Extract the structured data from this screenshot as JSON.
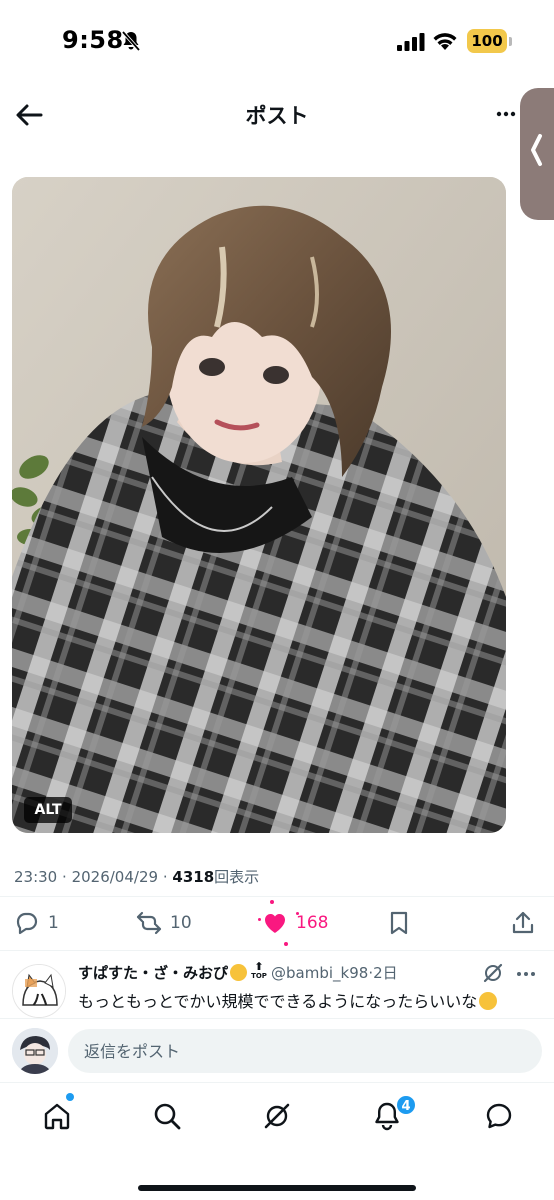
{
  "status_bar": {
    "time": "9:58",
    "battery": "100",
    "icons": [
      "bell-slash-icon",
      "signal-icon",
      "wifi-icon",
      "battery-icon"
    ]
  },
  "header": {
    "title": "ポスト",
    "icons": [
      "back-arrow-icon",
      "more-icon"
    ]
  },
  "media": {
    "alt_label": "ALT",
    "description": "selfie photo"
  },
  "meta": {
    "time": "23:30",
    "date": "2026/04/29",
    "views": "4318",
    "views_label": "回表示",
    "separator": "·"
  },
  "actions": {
    "reply_count": "1",
    "repost_count": "10",
    "like_count": "168",
    "liked": true,
    "like_color": "#f91880",
    "icons": [
      "reply-icon",
      "repost-icon",
      "heart-icon",
      "bookmark-icon",
      "share-icon"
    ]
  },
  "reply": {
    "name": "すぱすた・ざ・みおぴ",
    "handle": "@bambi_k98",
    "time": "2日",
    "top_label": "TOP",
    "text": "もっともっとでかい規模でできるようになったらいいな"
  },
  "compose": {
    "placeholder": "返信をポスト"
  },
  "bottom_nav": {
    "items": [
      "home",
      "search",
      "grok",
      "notifications",
      "messages"
    ],
    "notification_count": "4",
    "accent": "#1d9bf0"
  },
  "colors": {
    "text_primary": "#0f1419",
    "text_secondary": "#536471",
    "accent": "#1d9bf0"
  }
}
